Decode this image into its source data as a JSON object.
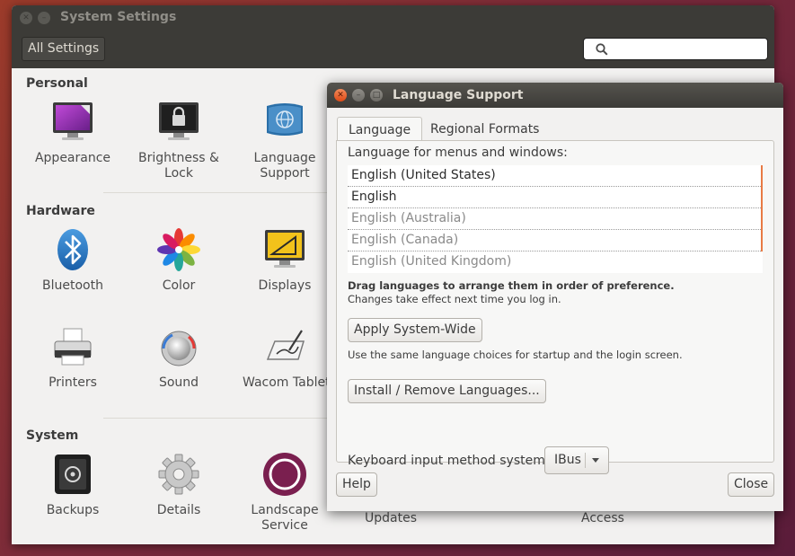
{
  "settings": {
    "title": "System Settings",
    "all_settings_label": "All Settings",
    "search_placeholder": "",
    "sections": {
      "personal": "Personal",
      "hardware": "Hardware",
      "system": "System"
    },
    "personal_items": [
      {
        "label": "Appearance",
        "icon": "appearance-icon"
      },
      {
        "label": "Brightness &\nLock",
        "icon": "brightness-lock-icon"
      },
      {
        "label": "Language\nSupport",
        "icon": "language-support-icon"
      }
    ],
    "hardware_items": [
      {
        "label": "Bluetooth",
        "icon": "bluetooth-icon"
      },
      {
        "label": "Color",
        "icon": "color-icon"
      },
      {
        "label": "Displays",
        "icon": "displays-icon"
      },
      {
        "label": "Printers",
        "icon": "printer-icon"
      },
      {
        "label": "Sound",
        "icon": "sound-icon"
      },
      {
        "label": "Wacom Tablet",
        "icon": "wacom-tablet-icon"
      }
    ],
    "system_items": [
      {
        "label": "Backups",
        "icon": "backups-icon"
      },
      {
        "label": "Details",
        "icon": "details-icon"
      },
      {
        "label": "Landscape\nService",
        "icon": "landscape-service-icon"
      },
      {
        "label": "Updates",
        "icon": "updates-icon"
      },
      {
        "label": "Access",
        "icon": "access-icon"
      }
    ]
  },
  "dialog": {
    "title": "Language Support",
    "tabs": [
      "Language",
      "Regional Formats"
    ],
    "list_label": "Language for menus and windows:",
    "languages": [
      {
        "name": "English (United States)",
        "state": "active"
      },
      {
        "name": "English",
        "state": "active"
      },
      {
        "name": "English (Australia)",
        "state": "inactive"
      },
      {
        "name": "English (Canada)",
        "state": "inactive"
      },
      {
        "name": "English (United Kingdom)",
        "state": "inactive"
      }
    ],
    "drag_hint": "Drag languages to arrange them in order of preference.",
    "changes_hint": "Changes take effect next time you log in.",
    "apply_button": "Apply System-Wide",
    "apply_hint": "Use the same language choices for startup and the login screen.",
    "install_button": "Install / Remove Languages...",
    "ime_label": "Keyboard input method system:",
    "ime_value": "IBus",
    "help_button": "Help",
    "close_button": "Close"
  },
  "colors": {
    "titlebar": "#3c3b37",
    "accent_orange": "#e87a44",
    "close_button": "#df4a16"
  }
}
